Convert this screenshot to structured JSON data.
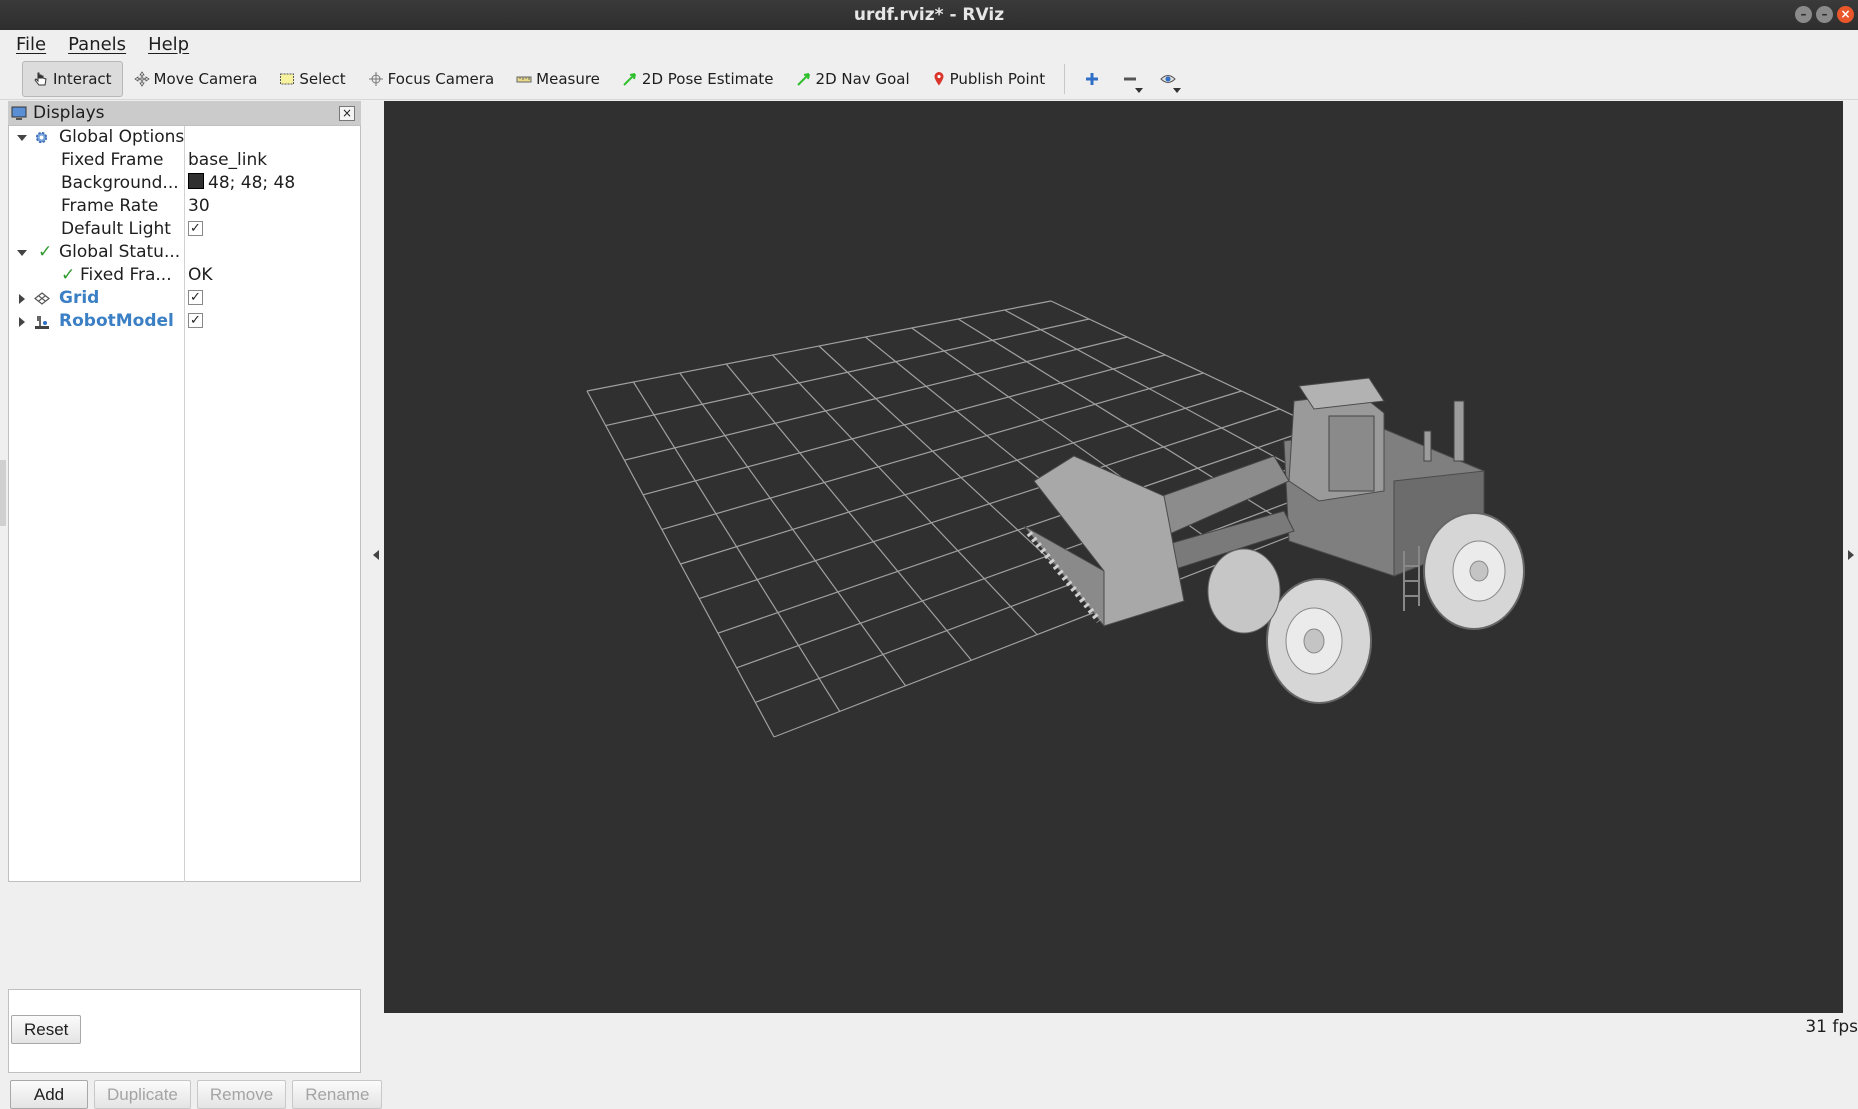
{
  "window": {
    "title": "urdf.rviz* - RViz"
  },
  "menu": {
    "file": "File",
    "panels": "Panels",
    "help": "Help"
  },
  "toolbar": {
    "interact": "Interact",
    "move_camera": "Move Camera",
    "select": "Select",
    "focus_camera": "Focus Camera",
    "measure": "Measure",
    "pose_estimate": "2D Pose Estimate",
    "nav_goal": "2D Nav Goal",
    "publish_point": "Publish Point",
    "active_tool": "Interact"
  },
  "displays": {
    "title": "Displays",
    "global_options": {
      "label": "Global Options",
      "fixed_frame_label": "Fixed Frame",
      "fixed_frame_value": "base_link",
      "background_label": "Background...",
      "background_value": "48; 48; 48",
      "background_color": "#303030",
      "frame_rate_label": "Frame Rate",
      "frame_rate_value": "30",
      "default_light_label": "Default Light",
      "default_light_checked": true
    },
    "global_status": {
      "label": "Global Statu...",
      "fixed_frame_label": "Fixed Fra...",
      "fixed_frame_value": "OK"
    },
    "grid": {
      "label": "Grid",
      "enabled": true
    },
    "robot_model": {
      "label": "RobotModel",
      "enabled": true
    }
  },
  "buttons": {
    "add": "Add",
    "duplicate": "Duplicate",
    "remove": "Remove",
    "rename": "Rename",
    "reset": "Reset"
  },
  "status": {
    "fps": "31 fps"
  },
  "colors": {
    "viewport_bg": "#303030",
    "link_blue": "#3b7fc4",
    "ok_green": "#2e9b2e"
  }
}
